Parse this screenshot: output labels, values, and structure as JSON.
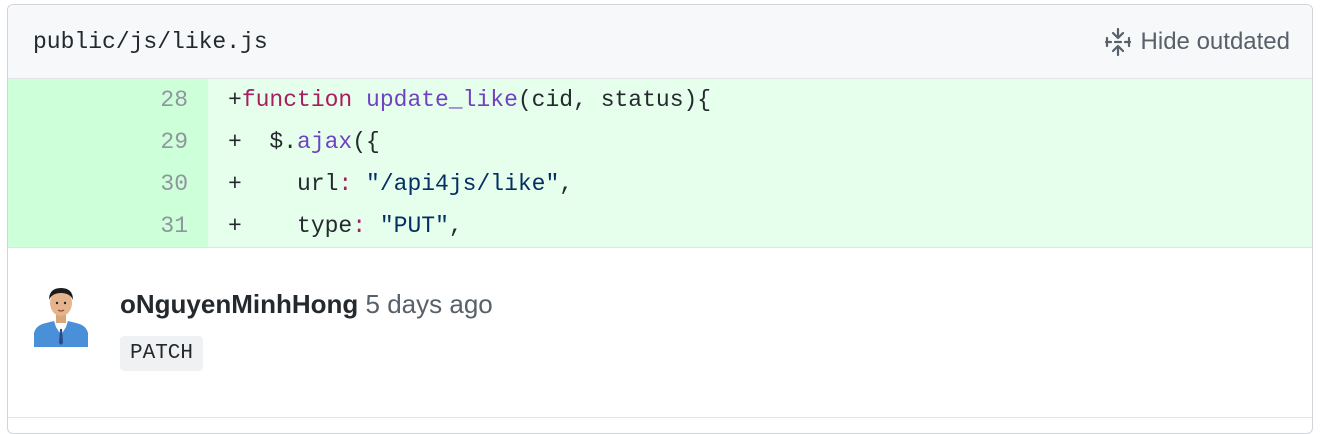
{
  "file": {
    "path": "public/js/like.js",
    "hide_outdated_label": "Hide outdated",
    "hide_outdated_icon": "fold-icon"
  },
  "diff": {
    "lines": [
      {
        "num": "28",
        "tokens": [
          {
            "text": "+",
            "cls": "plain"
          },
          {
            "text": "function",
            "cls": "keyword"
          },
          {
            "text": " ",
            "cls": "plain"
          },
          {
            "text": "update_like",
            "cls": "func"
          },
          {
            "text": "(cid, status){",
            "cls": "plain"
          }
        ]
      },
      {
        "num": "29",
        "tokens": [
          {
            "text": "+  $.",
            "cls": "plain"
          },
          {
            "text": "ajax",
            "cls": "func"
          },
          {
            "text": "({",
            "cls": "plain"
          }
        ]
      },
      {
        "num": "30",
        "tokens": [
          {
            "text": "+    url",
            "cls": "plain"
          },
          {
            "text": ":",
            "cls": "keyword"
          },
          {
            "text": " ",
            "cls": "plain"
          },
          {
            "text": "\"/api4js/like\"",
            "cls": "string"
          },
          {
            "text": ",",
            "cls": "plain"
          }
        ]
      },
      {
        "num": "31",
        "tokens": [
          {
            "text": "+    type",
            "cls": "plain"
          },
          {
            "text": ":",
            "cls": "keyword"
          },
          {
            "text": " ",
            "cls": "plain"
          },
          {
            "text": "\"PUT\"",
            "cls": "string"
          },
          {
            "text": ",",
            "cls": "plain"
          }
        ]
      }
    ],
    "colors": {
      "added_bg": "#e6ffed",
      "added_num_bg": "#cdffd8"
    }
  },
  "comment": {
    "author": "oNguyenMinhHong",
    "timestamp": "5 days ago",
    "body_code": "PATCH",
    "avatar_icon": "user-avatar"
  }
}
